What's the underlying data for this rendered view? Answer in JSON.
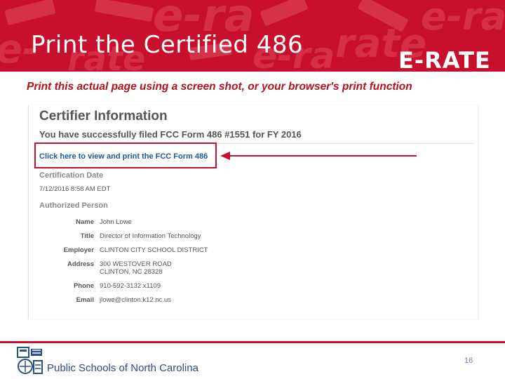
{
  "slide": {
    "title": "Print the Certified 486",
    "logo_text": "E-RATE",
    "subtitle": "Print this actual page using a screen shot, or your browser's print function",
    "page_number": "16",
    "footer_org": "Public Schools of North Carolina",
    "colors": {
      "brand_red": "#c8102e",
      "link_blue": "#1c5a97",
      "footer_blue": "#2a4f86"
    }
  },
  "certifier": {
    "heading": "Certifier Information",
    "status": "You have successfully filed FCC Form 486 #1551 for FY 2016",
    "view_link": "Click here to view and print the FCC Form 486",
    "cert_date_label": "Certification Date",
    "cert_date": "7/12/2016 8:58 AM EDT",
    "person_label": "Authorized Person",
    "fields": {
      "name": {
        "label": "Name",
        "value": "John Lowe"
      },
      "title": {
        "label": "Title",
        "value": "Director of Information Technology"
      },
      "employer": {
        "label": "Employer",
        "value": "CLINTON CITY SCHOOL DISTRICT"
      },
      "address": {
        "label": "Address",
        "line1": "300 WESTOVER ROAD",
        "line2": "CLINTON, NC 28328"
      },
      "phone": {
        "label": "Phone",
        "value": "910-592-3132 x1109"
      },
      "email": {
        "label": "Email",
        "value": "jlowe@clinton.k12.nc.us"
      }
    }
  }
}
